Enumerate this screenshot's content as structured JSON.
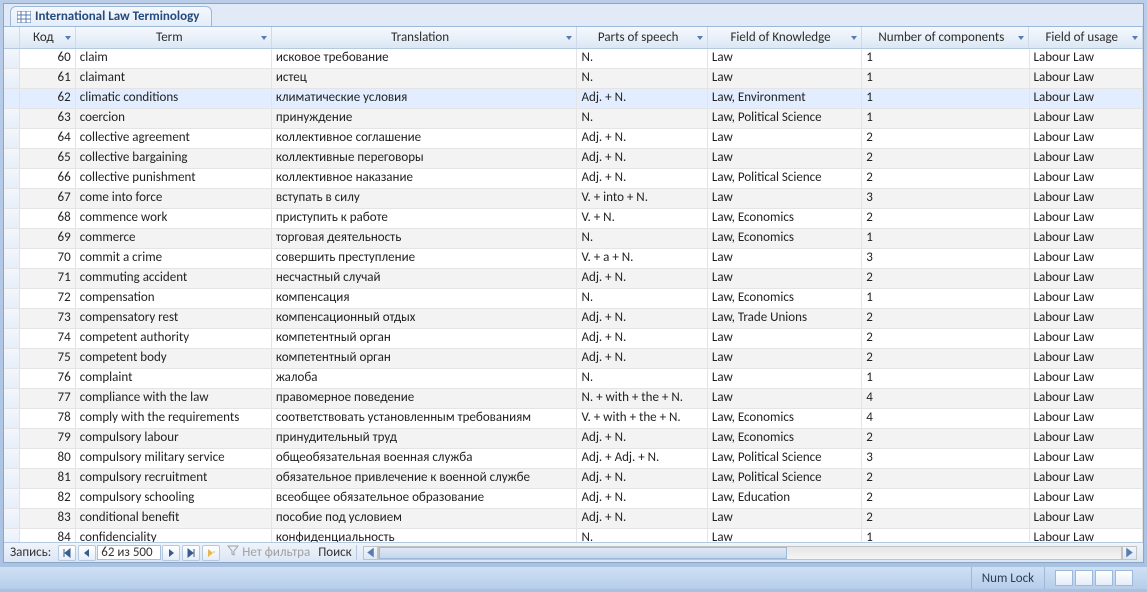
{
  "tab_title": "International Law Terminology",
  "columns": {
    "kod": "Код",
    "term": "Term",
    "translation": "Translation",
    "pos": "Parts of speech",
    "fok": "Field of Knowledge",
    "nc": "Number of components",
    "fu": "Field of usage"
  },
  "selected_row_index": 2,
  "rows": [
    {
      "kod": "60",
      "term": "claim",
      "translation": "исковое требование",
      "pos": "N.",
      "fok": "Law",
      "nc": "1",
      "fu": "Labour Law"
    },
    {
      "kod": "61",
      "term": "claimant",
      "translation": "истец",
      "pos": "N.",
      "fok": "Law",
      "nc": "1",
      "fu": "Labour Law"
    },
    {
      "kod": "62",
      "term": "climatic conditions",
      "translation": "климатические условия",
      "pos": "Adj. + N.",
      "fok": "Law, Environment",
      "nc": "1",
      "fu": "Labour Law"
    },
    {
      "kod": "63",
      "term": "coercion",
      "translation": "принуждение",
      "pos": "N.",
      "fok": "Law, Political Science",
      "nc": "1",
      "fu": "Labour Law"
    },
    {
      "kod": "64",
      "term": "collective agreement",
      "translation": "коллективное соглашение",
      "pos": "Adj. + N.",
      "fok": "Law",
      "nc": "2",
      "fu": "Labour Law"
    },
    {
      "kod": "65",
      "term": "collective bargaining",
      "translation": "коллективные переговоры",
      "pos": "Adj. + N.",
      "fok": "Law",
      "nc": "2",
      "fu": "Labour Law"
    },
    {
      "kod": "66",
      "term": "collective punishment",
      "translation": "коллективное наказание",
      "pos": "Adj. + N.",
      "fok": "Law, Political Science",
      "nc": "2",
      "fu": "Labour Law"
    },
    {
      "kod": "67",
      "term": "come into force",
      "translation": "вступать в силу",
      "pos": "V. + into + N.",
      "fok": "Law",
      "nc": "3",
      "fu": "Labour Law"
    },
    {
      "kod": "68",
      "term": "commence work",
      "translation": "приступить к работе",
      "pos": "V. + N.",
      "fok": "Law, Economics",
      "nc": "2",
      "fu": "Labour Law"
    },
    {
      "kod": "69",
      "term": "commerce",
      "translation": "торговая деятельность",
      "pos": "N.",
      "fok": "Law, Economics",
      "nc": "1",
      "fu": "Labour Law"
    },
    {
      "kod": "70",
      "term": "commit a crime",
      "translation": "совершить преступление",
      "pos": "V. + a + N.",
      "fok": "Law",
      "nc": "3",
      "fu": "Labour Law"
    },
    {
      "kod": "71",
      "term": "commuting accident",
      "translation": "несчастный случай",
      "pos": "Adj. + N.",
      "fok": "Law",
      "nc": "2",
      "fu": "Labour Law"
    },
    {
      "kod": "72",
      "term": "compensation",
      "translation": "компенсация",
      "pos": "N.",
      "fok": "Law, Economics",
      "nc": "1",
      "fu": "Labour Law"
    },
    {
      "kod": "73",
      "term": "compensatory rest",
      "translation": "компенсационный отдых",
      "pos": "Adj. + N.",
      "fok": "Law, Trade Unions",
      "nc": "2",
      "fu": "Labour Law"
    },
    {
      "kod": "74",
      "term": "competent authority",
      "translation": "компетентный орган",
      "pos": "Adj. + N.",
      "fok": "Law",
      "nc": "2",
      "fu": "Labour Law"
    },
    {
      "kod": "75",
      "term": "competent body",
      "translation": "компетентный орган",
      "pos": "Adj. + N.",
      "fok": "Law",
      "nc": "2",
      "fu": "Labour Law"
    },
    {
      "kod": "76",
      "term": "complaint",
      "translation": "жалоба",
      "pos": "N.",
      "fok": "Law",
      "nc": "1",
      "fu": "Labour Law"
    },
    {
      "kod": "77",
      "term": "compliance with the law",
      "translation": "правомерное поведение",
      "pos": "N. + with + the + N.",
      "fok": "Law",
      "nc": "4",
      "fu": "Labour Law"
    },
    {
      "kod": "78",
      "term": "comply with the requirements",
      "translation": "соответствовать установленным требованиям",
      "pos": "V. + with + the + N.",
      "fok": "Law, Economics",
      "nc": "4",
      "fu": "Labour Law"
    },
    {
      "kod": "79",
      "term": "compulsory labour",
      "translation": "принудительный труд",
      "pos": "Adj. + N.",
      "fok": "Law, Economics",
      "nc": "2",
      "fu": "Labour Law"
    },
    {
      "kod": "80",
      "term": "compulsory military service",
      "translation": "общеобязательная военная служба",
      "pos": "Adj. + Adj. + N.",
      "fok": "Law, Political Science",
      "nc": "3",
      "fu": "Labour Law"
    },
    {
      "kod": "81",
      "term": "compulsory recruitment",
      "translation": "обязательное привлечение к военной службе",
      "pos": "Adj. + N.",
      "fok": "Law, Political Science",
      "nc": "2",
      "fu": "Labour Law"
    },
    {
      "kod": "82",
      "term": "compulsory schooling",
      "translation": "всеобщее обязательное образование",
      "pos": "Adj. + N.",
      "fok": "Law, Education",
      "nc": "2",
      "fu": "Labour Law"
    },
    {
      "kod": "83",
      "term": "conditional benefit",
      "translation": "пособие под условием",
      "pos": "Adj. + N.",
      "fok": "Law",
      "nc": "2",
      "fu": "Labour Law"
    },
    {
      "kod": "84",
      "term": "confidenciality",
      "translation": "конфиденциальность",
      "pos": "N.",
      "fok": "Law",
      "nc": "1",
      "fu": "Labour Law"
    }
  ],
  "nav": {
    "label": "Запись:",
    "position_text": "62 из 500",
    "filter_text": "Нет фильтра",
    "search_label": "Поиск"
  },
  "status": {
    "numlock": "Num Lock"
  }
}
